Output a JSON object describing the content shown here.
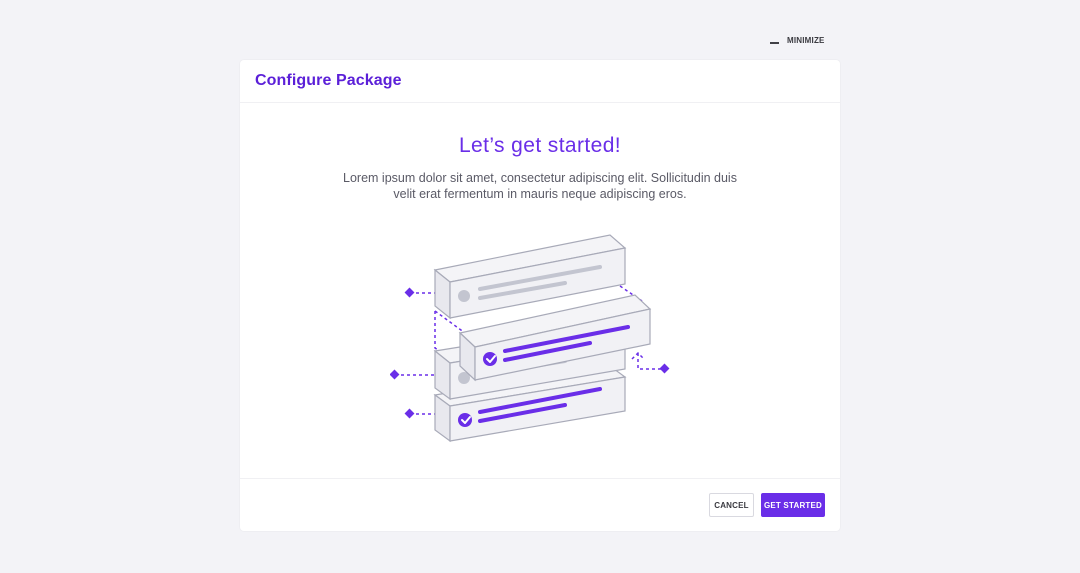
{
  "window": {
    "minimize_label": "MINIMIZE"
  },
  "modal": {
    "title": "Configure Package",
    "headline": "Let’s get started!",
    "description": "Lorem ipsum dolor sit amet, consectetur adipiscing elit. Sollicitudin duis velit erat fermentum in mauris neque adipiscing eros.",
    "footer": {
      "cancel_label": "CANCEL",
      "primary_label": "GET STARTED"
    }
  },
  "colors": {
    "accent": "#6a2ee8",
    "title": "#5b1fd8",
    "background": "#f3f3f7",
    "panel": "#ffffff",
    "muted_stroke": "#a8aab8"
  },
  "icons": {
    "minimize": "minimize-icon",
    "check": "check-circle-icon",
    "placeholder": "avatar-placeholder-icon"
  }
}
